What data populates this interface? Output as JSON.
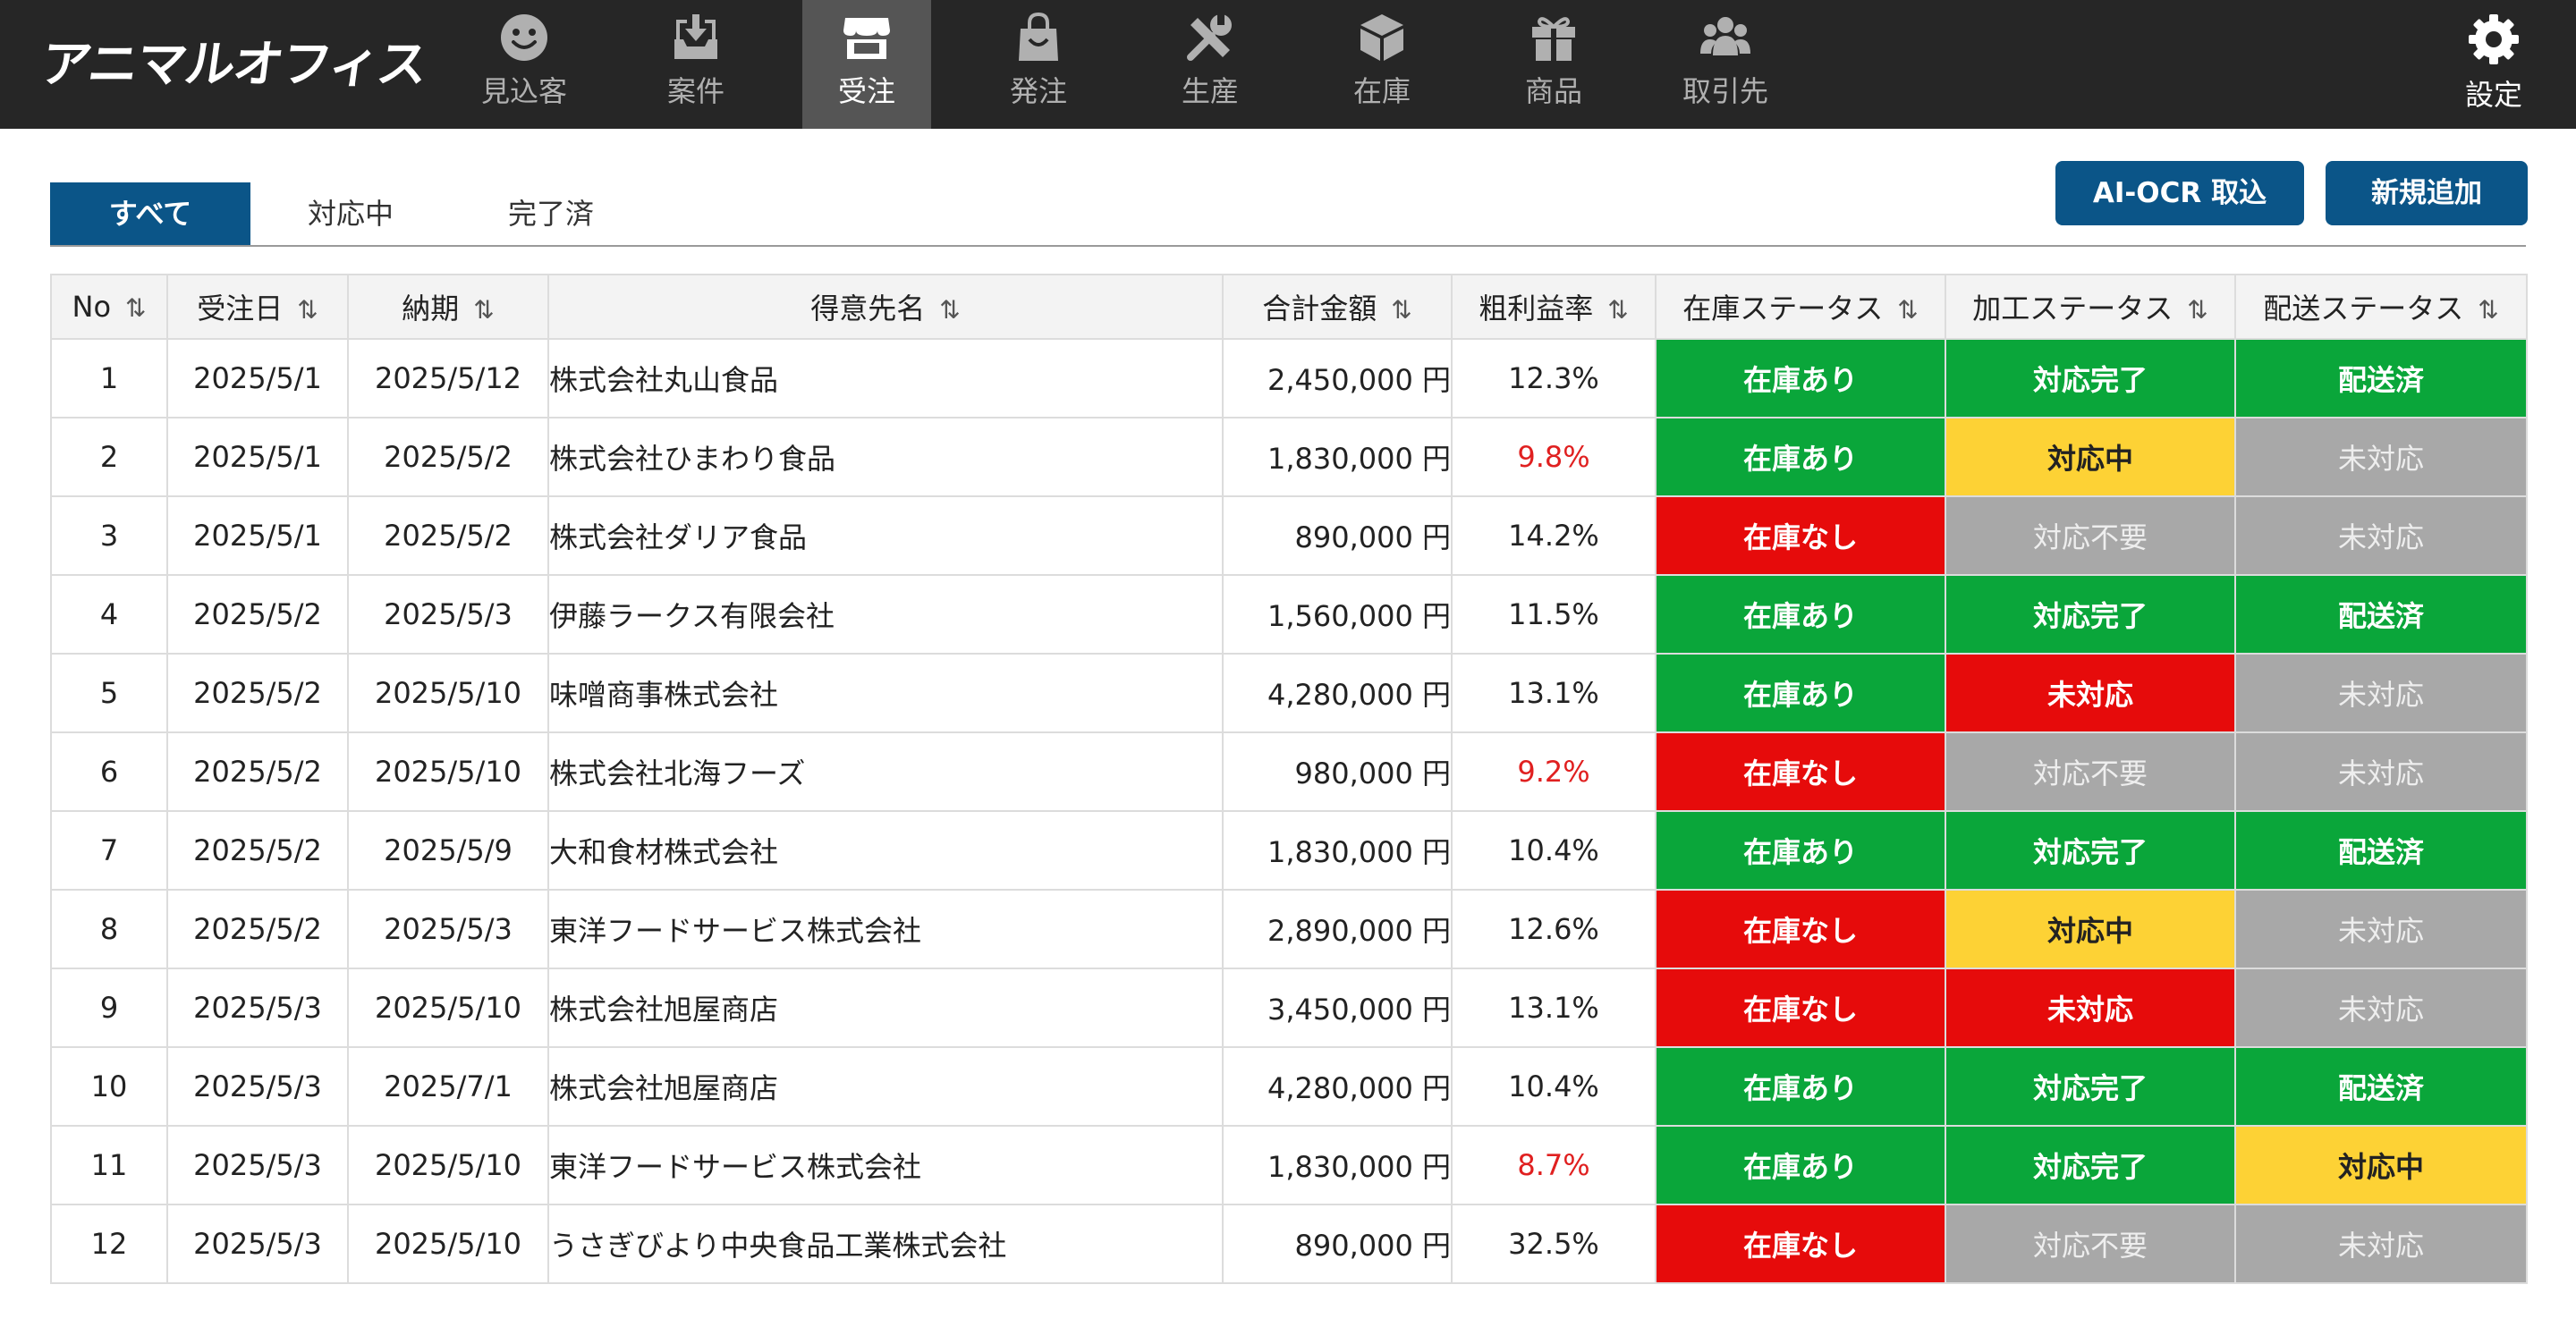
{
  "app": {
    "logo": "アニマルオフィス"
  },
  "nav": {
    "items": [
      {
        "label": "見込客",
        "icon": "smiley-icon",
        "active": false
      },
      {
        "label": "案件",
        "icon": "inbox-download-icon",
        "active": false
      },
      {
        "label": "受注",
        "icon": "storefront-icon",
        "active": true
      },
      {
        "label": "発注",
        "icon": "shopping-bag-icon",
        "active": false
      },
      {
        "label": "生産",
        "icon": "tools-icon",
        "active": false
      },
      {
        "label": "在庫",
        "icon": "box-icon",
        "active": false
      },
      {
        "label": "商品",
        "icon": "gift-icon",
        "active": false
      },
      {
        "label": "取引先",
        "icon": "users-icon",
        "active": false
      }
    ],
    "settings": {
      "label": "設定",
      "icon": "gear-icon"
    }
  },
  "tabs": [
    {
      "label": "すべて",
      "active": true
    },
    {
      "label": "対応中",
      "active": false
    },
    {
      "label": "完了済",
      "active": false
    }
  ],
  "actions": {
    "ocr": "AI-OCR 取込",
    "add": "新規追加"
  },
  "table": {
    "headers": {
      "no": "No",
      "order_date": "受注日",
      "delivery": "納期",
      "customer": "得意先名",
      "total": "合計金額",
      "margin": "粗利益率",
      "stock": "在庫ステータス",
      "process": "加工ステータス",
      "ship": "配送ステータス"
    },
    "sort_icon": "⇅",
    "rows": [
      {
        "no": "1",
        "order_date": "2025/5/1",
        "delivery": "2025/5/12",
        "customer": "株式会社丸山食品",
        "total": "2,450,000 円",
        "margin": "12.3%",
        "margin_low": false,
        "stock": "在庫あり",
        "stock_color": "green",
        "process": "対応完了",
        "process_color": "green",
        "ship": "配送済",
        "ship_color": "green"
      },
      {
        "no": "2",
        "order_date": "2025/5/1",
        "delivery": "2025/5/2",
        "customer": "株式会社ひまわり食品",
        "total": "1,830,000  円",
        "margin": "9.8%",
        "margin_low": true,
        "stock": "在庫あり",
        "stock_color": "green",
        "process": "対応中",
        "process_color": "yellow",
        "ship": "未対応",
        "ship_color": "gray"
      },
      {
        "no": "3",
        "order_date": "2025/5/1",
        "delivery": "2025/5/2",
        "customer": "株式会社ダリア食品",
        "total": "890,000 円",
        "margin": "14.2%",
        "margin_low": false,
        "stock": "在庫なし",
        "stock_color": "red",
        "process": "対応不要",
        "process_color": "gray",
        "ship": "未対応",
        "ship_color": "gray"
      },
      {
        "no": "4",
        "order_date": "2025/5/2",
        "delivery": "2025/5/3",
        "customer": "伊藤ラークス有限会社",
        "total": "1,560,000  円",
        "margin": "11.5%",
        "margin_low": false,
        "stock": "在庫あり",
        "stock_color": "green",
        "process": "対応完了",
        "process_color": "green",
        "ship": "配送済",
        "ship_color": "green"
      },
      {
        "no": "5",
        "order_date": "2025/5/2",
        "delivery": "2025/5/10",
        "customer": "味噌商事株式会社",
        "total": "4,280,000 円",
        "margin": "13.1%",
        "margin_low": false,
        "stock": "在庫あり",
        "stock_color": "green",
        "process": "未対応",
        "process_color": "red",
        "ship": "未対応",
        "ship_color": "gray"
      },
      {
        "no": "6",
        "order_date": "2025/5/2",
        "delivery": "2025/5/10",
        "customer": "株式会社北海フーズ",
        "total": "980,000 円",
        "margin": "9.2%",
        "margin_low": true,
        "stock": "在庫なし",
        "stock_color": "red",
        "process": "対応不要",
        "process_color": "gray",
        "ship": "未対応",
        "ship_color": "gray"
      },
      {
        "no": "7",
        "order_date": "2025/5/2",
        "delivery": "2025/5/9",
        "customer": "大和食材株式会社",
        "total": "1,830,000  円",
        "margin": "10.4%",
        "margin_low": false,
        "stock": "在庫あり",
        "stock_color": "green",
        "process": "対応完了",
        "process_color": "green",
        "ship": "配送済",
        "ship_color": "green"
      },
      {
        "no": "8",
        "order_date": "2025/5/2",
        "delivery": "2025/5/3",
        "customer": "東洋フードサービス株式会社",
        "total": "2,890,000  円",
        "margin": "12.6%",
        "margin_low": false,
        "stock": "在庫なし",
        "stock_color": "red",
        "process": "対応中",
        "process_color": "yellow",
        "ship": "未対応",
        "ship_color": "gray"
      },
      {
        "no": "9",
        "order_date": "2025/5/3",
        "delivery": "2025/5/10",
        "customer": "株式会社旭屋商店",
        "total": "3,450,000  円",
        "margin": "13.1%",
        "margin_low": false,
        "stock": "在庫なし",
        "stock_color": "red",
        "process": "未対応",
        "process_color": "red",
        "ship": "未対応",
        "ship_color": "gray"
      },
      {
        "no": "10",
        "order_date": "2025/5/3",
        "delivery": "2025/7/1",
        "customer": "株式会社旭屋商店",
        "total": "4,280,000  円",
        "margin": "10.4%",
        "margin_low": false,
        "stock": "在庫あり",
        "stock_color": "green",
        "process": "対応完了",
        "process_color": "green",
        "ship": "配送済",
        "ship_color": "green"
      },
      {
        "no": "11",
        "order_date": "2025/5/3",
        "delivery": "2025/5/10",
        "customer": "東洋フードサービス株式会社",
        "total": "1,830,000  円",
        "margin": "8.7%",
        "margin_low": true,
        "stock": "在庫あり",
        "stock_color": "green",
        "process": "対応完了",
        "process_color": "green",
        "ship": "対応中",
        "ship_color": "yellow"
      },
      {
        "no": "12",
        "order_date": "2025/5/3",
        "delivery": "2025/5/10",
        "customer": "うさぎびより中央食品工業株式会社",
        "total": "890,000  円",
        "margin": "32.5%",
        "margin_low": false,
        "stock": "在庫なし",
        "stock_color": "red",
        "process": "対応不要",
        "process_color": "gray",
        "ship": "未対応",
        "ship_color": "gray"
      }
    ]
  },
  "colors": {
    "primary": "#0b5588",
    "green": "#0aa63a",
    "red": "#e60b0b",
    "yellow": "#fdd235",
    "gray": "#a8a8a8",
    "low_margin_text": "#e02020",
    "topbar": "#262626"
  }
}
